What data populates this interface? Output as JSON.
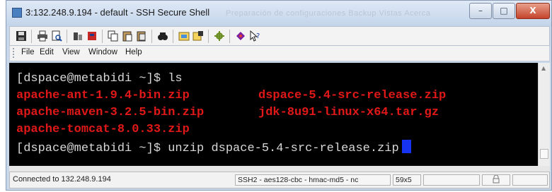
{
  "window": {
    "title": "3:132.248.9.194 - default - SSH Secure Shell",
    "ghost_tabs": "Preparación de configuraciones    Backup    Vistas    Acerca",
    "controls": {
      "minimize": "–",
      "maximize": "□",
      "close": "X"
    }
  },
  "toolbar": {
    "icons": [
      "save-icon",
      "print-icon",
      "print-preview-icon",
      "quick-connect-icon",
      "profiles-icon",
      "copy-icon",
      "paste-icon",
      "paste-all-icon",
      "find-icon",
      "file-transfer-icon",
      "new-terminal-icon",
      "settings-icon",
      "help-context-icon",
      "whats-this-icon"
    ]
  },
  "menu": [
    {
      "label": "File"
    },
    {
      "label": "Edit"
    },
    {
      "label": "View"
    },
    {
      "label": "Window"
    },
    {
      "label": "Help"
    }
  ],
  "terminal": {
    "line1_prompt": "[dspace@metabidi ~]$ ls",
    "files_row1_a": "apache-ant-1.9.4-bin.zip",
    "files_row1_b": "dspace-5.4-src-release.zip",
    "files_row2_a": "apache-maven-3.2.5-bin.zip",
    "files_row2_b": "jdk-8u91-linux-x64.tar.gz",
    "files_row3_a": "apache-tomcat-8.0.33.zip",
    "line5_prompt": "[dspace@metabidi ~]$ unzip dspace-5.4-src-release.zip",
    "colors": {
      "background": "#000000",
      "prompt": "#d8d8d8",
      "file": "#e01818",
      "cursor": "#1533f0"
    }
  },
  "status": {
    "connection": "Connected to 132.248.9.194",
    "cipher": "SSH2 - aes128-cbc - hmac-md5 - nc",
    "size": "59x5"
  }
}
